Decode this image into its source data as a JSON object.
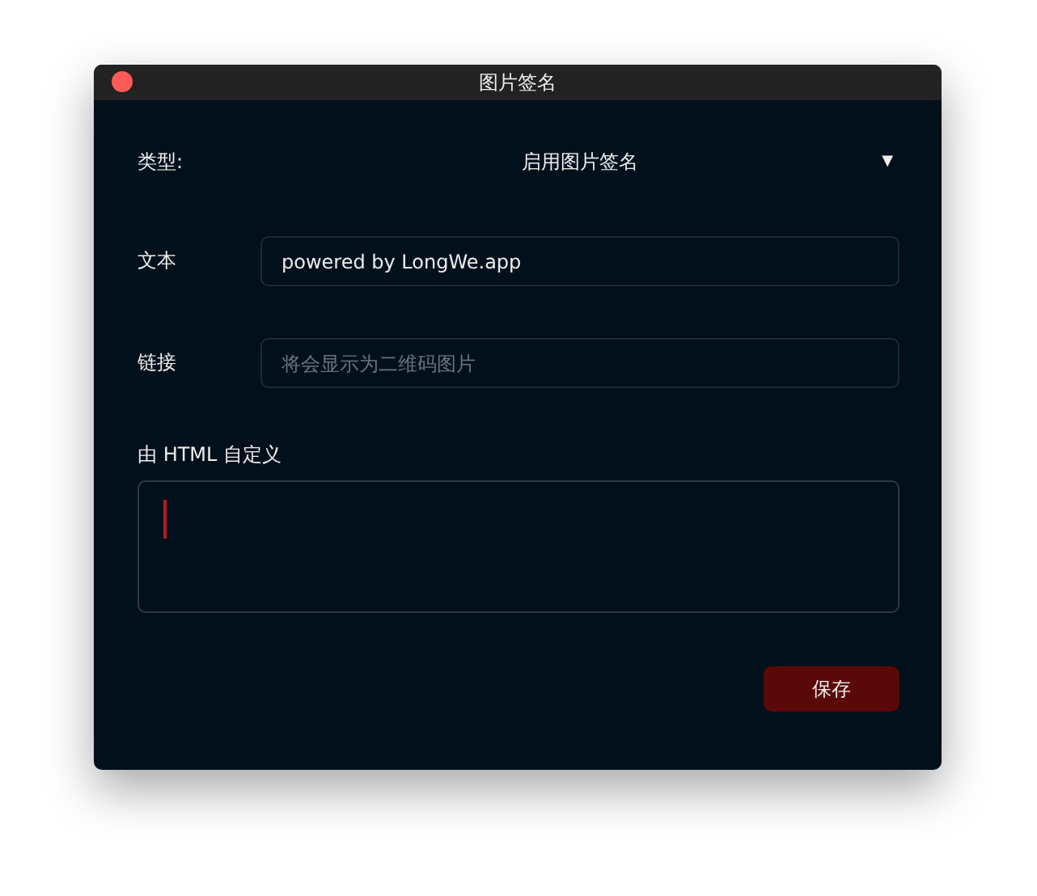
{
  "window": {
    "title": "图片签名"
  },
  "type_select": {
    "label": "类型:",
    "value": "启用图片签名",
    "arrow": "▼"
  },
  "fields": [
    {
      "label": "文本",
      "value": "powered by LongWe.app"
    },
    {
      "label": "链接",
      "placeholder": "将会显示为二维码图片"
    }
  ],
  "html_editor": {
    "label": "由 HTML 自定义",
    "focused": true
  },
  "buttons": [
    {
      "label": "保存"
    }
  ]
}
